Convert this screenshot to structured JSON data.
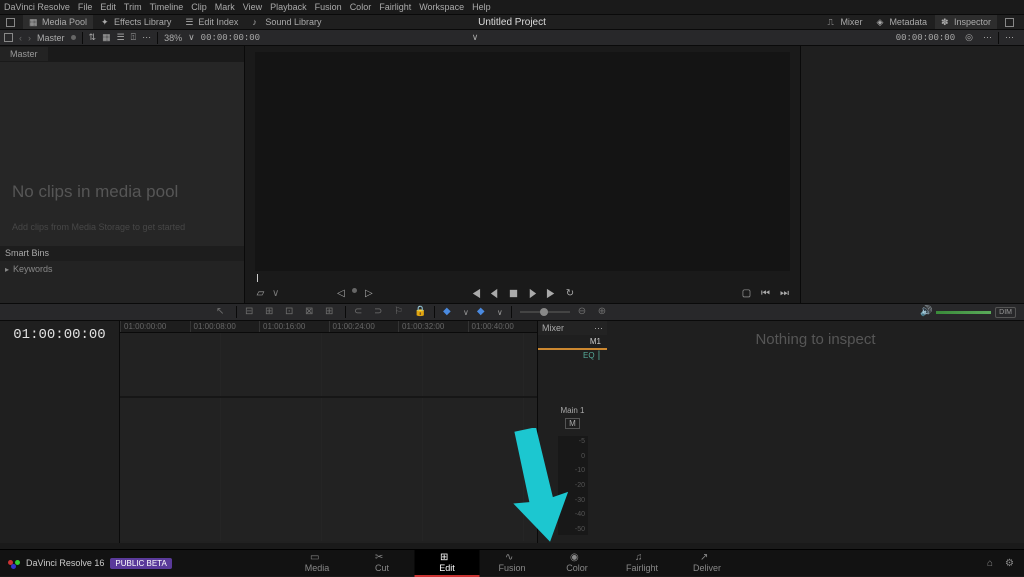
{
  "menu": [
    "DaVinci Resolve",
    "File",
    "Edit",
    "Trim",
    "Timeline",
    "Clip",
    "Mark",
    "View",
    "Playback",
    "Fusion",
    "Color",
    "Fairlight",
    "Workspace",
    "Help"
  ],
  "toolbar": {
    "media_pool": "Media Pool",
    "effects": "Effects Library",
    "edit_index": "Edit Index",
    "sound": "Sound Library",
    "mixer": "Mixer",
    "metadata": "Metadata",
    "inspector": "Inspector"
  },
  "project_title": "Untitled Project",
  "subbar": {
    "master": "Master",
    "zoom": "38%",
    "tc": "00:00:00:00",
    "right_tc": "00:00:00:00"
  },
  "mediapool": {
    "tab": "Master",
    "noclips": "No clips in media pool",
    "hint": "Add clips from Media Storage to get started",
    "smart": "Smart Bins",
    "keywords": "Keywords"
  },
  "timeline": {
    "tc": "01:00:00:00",
    "ruler": [
      "01:00:00:00",
      "01:00:08:00",
      "01:00:16:00",
      "01:00:24:00",
      "01:00:32:00",
      "01:00:40:00"
    ]
  },
  "mixer": {
    "title": "Mixer",
    "m1": "M1",
    "eq": "EQ",
    "main": "Main 1",
    "m": "M",
    "scale": [
      "-5",
      "0",
      "-10",
      "-20",
      "-30",
      "-40",
      "-50"
    ]
  },
  "inspector": {
    "empty": "Nothing to inspect"
  },
  "vol": {
    "dim": "DIM"
  },
  "bottom": {
    "name": "DaVinci Resolve 16",
    "beta": "PUBLIC BETA",
    "pages": [
      "Media",
      "Cut",
      "Edit",
      "Fusion",
      "Color",
      "Fairlight",
      "Deliver"
    ],
    "active": 2
  }
}
